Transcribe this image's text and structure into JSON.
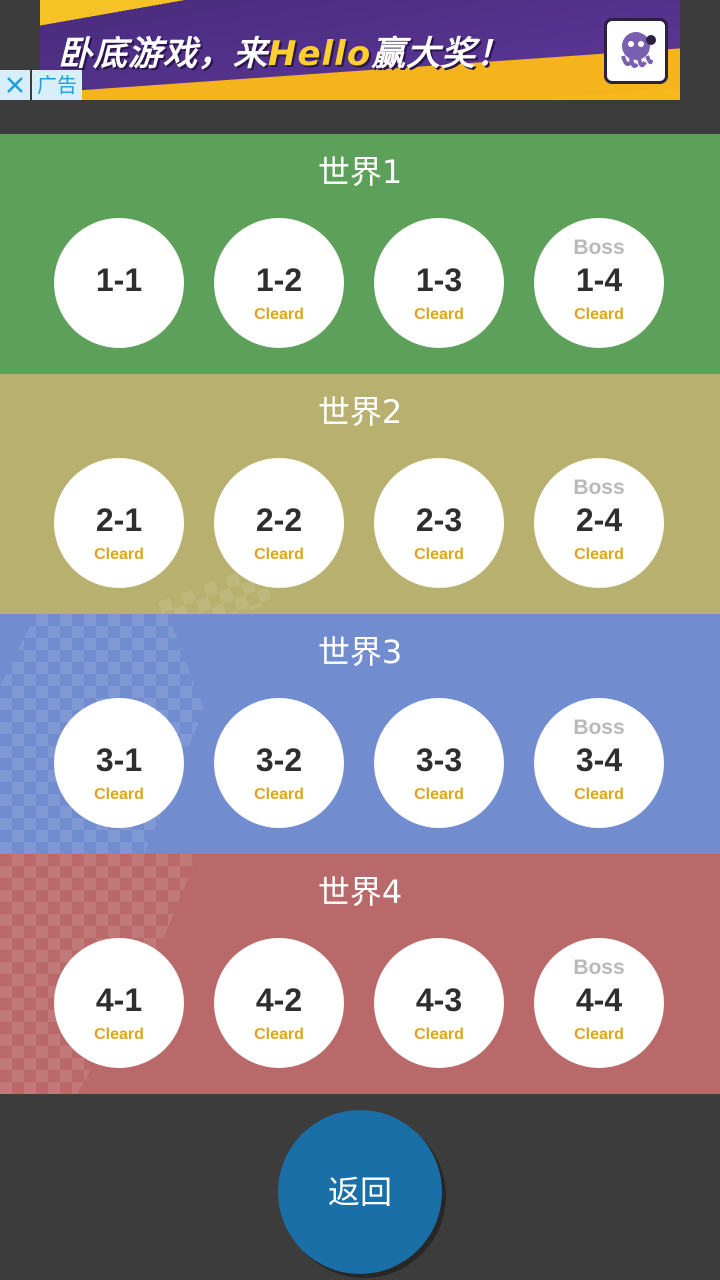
{
  "ad": {
    "banner_text_prefix": "卧底游戏，来",
    "banner_text_highlight": "Hello",
    "banner_text_suffix": "赢大奖！",
    "tag_label": "广告",
    "close_icon": "close-icon",
    "logo_icon": "octopus-logo-icon"
  },
  "colors": {
    "background": "#3c3c3c",
    "world1": "#5da05a",
    "world2": "#b8b06e",
    "world3": "#728dcf",
    "world4": "#b9696a",
    "back_button": "#1b6fa7",
    "status_text": "#dca61d",
    "boss_text": "#b9b9b9"
  },
  "worlds": [
    {
      "title": "世界1",
      "levels": [
        {
          "boss": "",
          "num": "1-1",
          "status": ""
        },
        {
          "boss": "",
          "num": "1-2",
          "status": "Cleard"
        },
        {
          "boss": "",
          "num": "1-3",
          "status": "Cleard"
        },
        {
          "boss": "Boss",
          "num": "1-4",
          "status": "Cleard"
        }
      ]
    },
    {
      "title": "世界2",
      "levels": [
        {
          "boss": "",
          "num": "2-1",
          "status": "Cleard"
        },
        {
          "boss": "",
          "num": "2-2",
          "status": "Cleard"
        },
        {
          "boss": "",
          "num": "2-3",
          "status": "Cleard"
        },
        {
          "boss": "Boss",
          "num": "2-4",
          "status": "Cleard"
        }
      ]
    },
    {
      "title": "世界3",
      "levels": [
        {
          "boss": "",
          "num": "3-1",
          "status": "Cleard"
        },
        {
          "boss": "",
          "num": "3-2",
          "status": "Cleard"
        },
        {
          "boss": "",
          "num": "3-3",
          "status": "Cleard"
        },
        {
          "boss": "Boss",
          "num": "3-4",
          "status": "Cleard"
        }
      ]
    },
    {
      "title": "世界4",
      "levels": [
        {
          "boss": "",
          "num": "4-1",
          "status": "Cleard"
        },
        {
          "boss": "",
          "num": "4-2",
          "status": "Cleard"
        },
        {
          "boss": "",
          "num": "4-3",
          "status": "Cleard"
        },
        {
          "boss": "Boss",
          "num": "4-4",
          "status": "Cleard"
        }
      ]
    }
  ],
  "back_button": {
    "label": "返回"
  }
}
